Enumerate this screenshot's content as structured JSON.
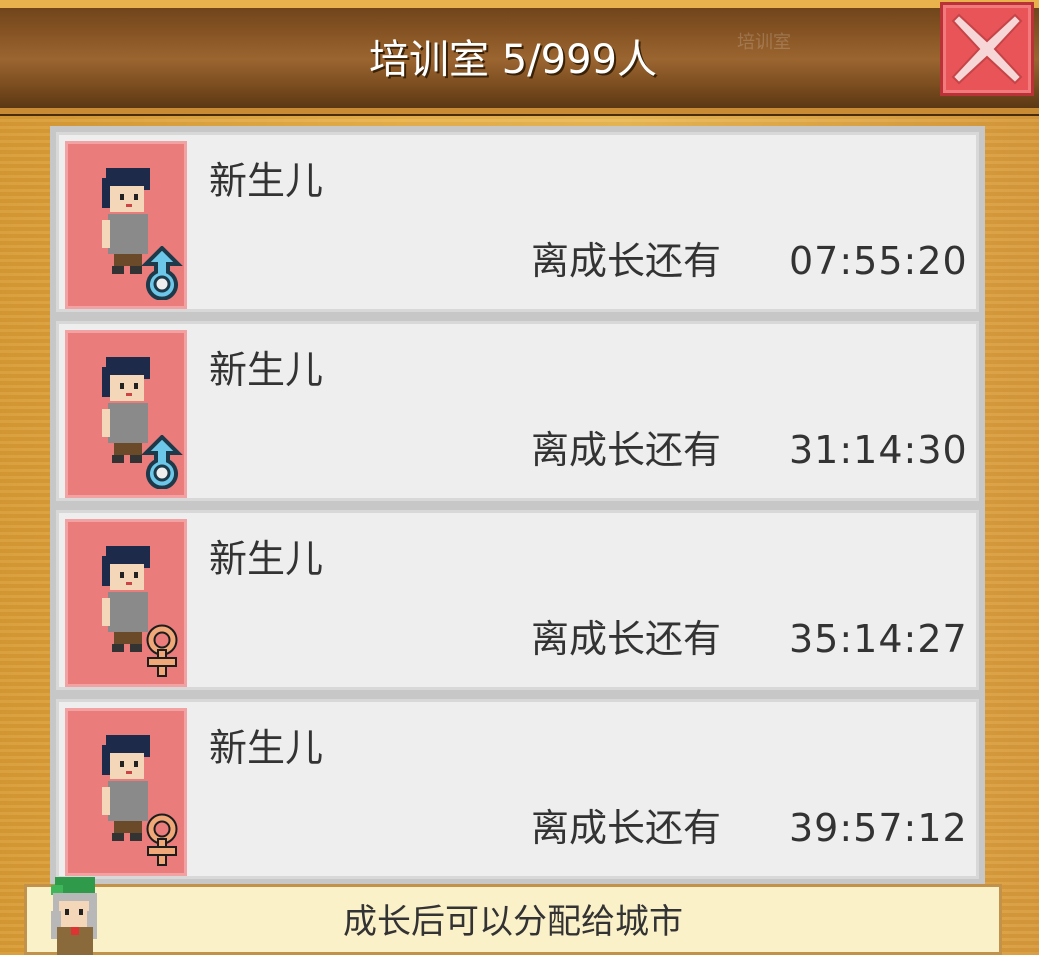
{
  "header": {
    "title": "培训室 5/999人",
    "ghost_label": "培训室",
    "close_icon": "close-icon"
  },
  "residents": [
    {
      "name": "新生儿",
      "growth_label": "离成长还有",
      "time_left": "07:55:20",
      "gender": "male",
      "icon": "male-symbol-icon"
    },
    {
      "name": "新生儿",
      "growth_label": "离成长还有",
      "time_left": "31:14:30",
      "gender": "male",
      "icon": "male-symbol-icon"
    },
    {
      "name": "新生儿",
      "growth_label": "离成长还有",
      "time_left": "35:14:27",
      "gender": "female",
      "icon": "female-symbol-icon"
    },
    {
      "name": "新生儿",
      "growth_label": "离成长还有",
      "time_left": "39:57:12",
      "gender": "female",
      "icon": "female-symbol-icon"
    }
  ],
  "footer": {
    "hint": "成长后可以分配给城市"
  },
  "colors": {
    "header_bg": "#8a5726",
    "close_bg": "#e85457",
    "portrait_bg": "#ea7c7c",
    "male_color": "#6cc7e8",
    "female_color": "#f0a878",
    "footer_bg": "#fbf1c9"
  }
}
